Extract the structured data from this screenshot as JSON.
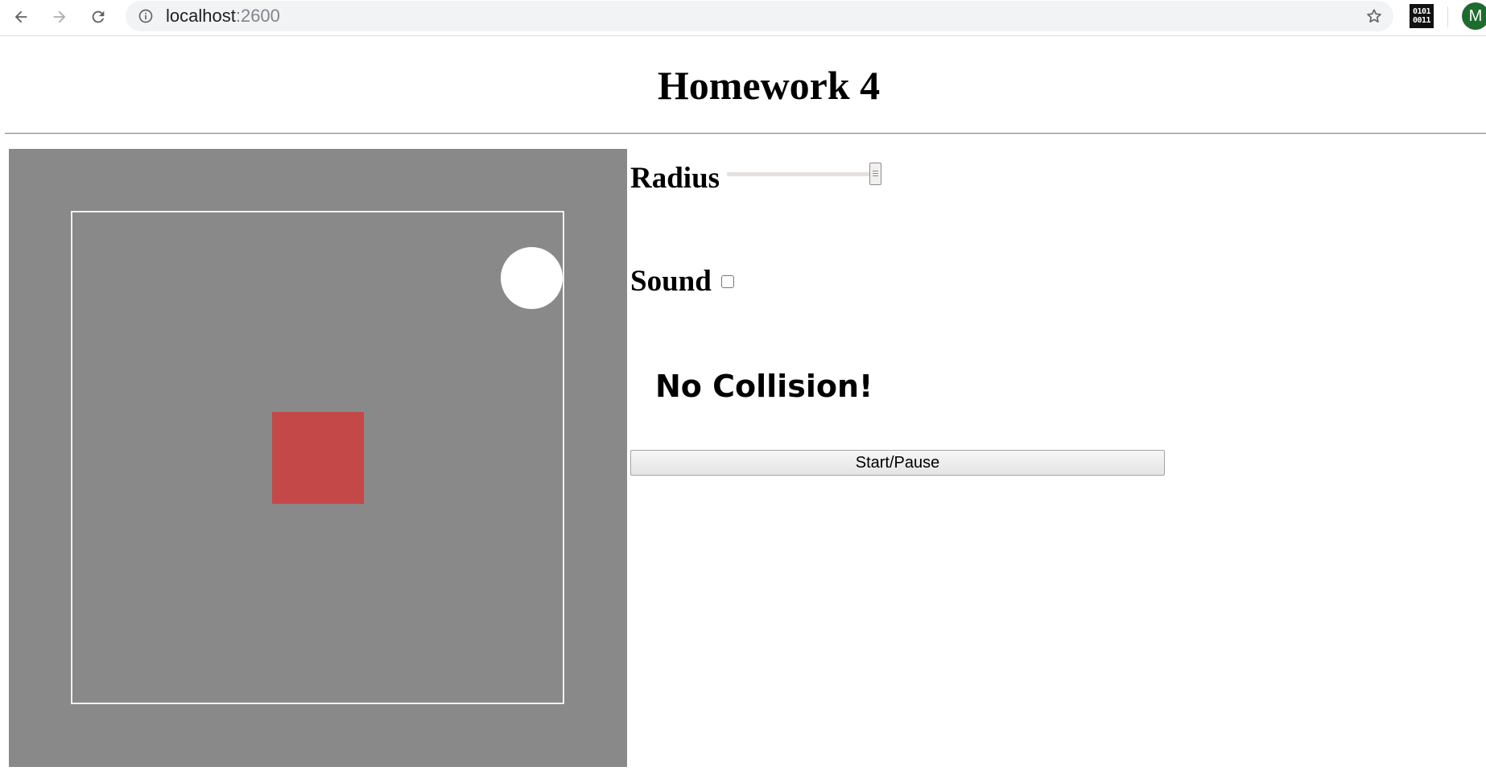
{
  "browser": {
    "url_host": "localhost",
    "url_port": ":2600",
    "extension_label_top": "0101",
    "extension_label_bottom": "0011",
    "avatar_initial": "M",
    "icons": {
      "back": "arrow-left-icon",
      "forward": "arrow-right-icon",
      "reload": "reload-icon",
      "info": "info-icon",
      "bookmark": "star-icon"
    }
  },
  "page": {
    "title": "Homework 4"
  },
  "canvas": {
    "background_color": "#898989",
    "boundary_color": "#f0f0f0",
    "ball_color": "#ffffff",
    "obstacle_color": "#c44848"
  },
  "controls": {
    "radius": {
      "label": "Radius",
      "value_fraction": 1.0
    },
    "sound": {
      "label": "Sound",
      "checked": false
    },
    "status": "No Collision!",
    "start_button_label": "Start/Pause"
  }
}
